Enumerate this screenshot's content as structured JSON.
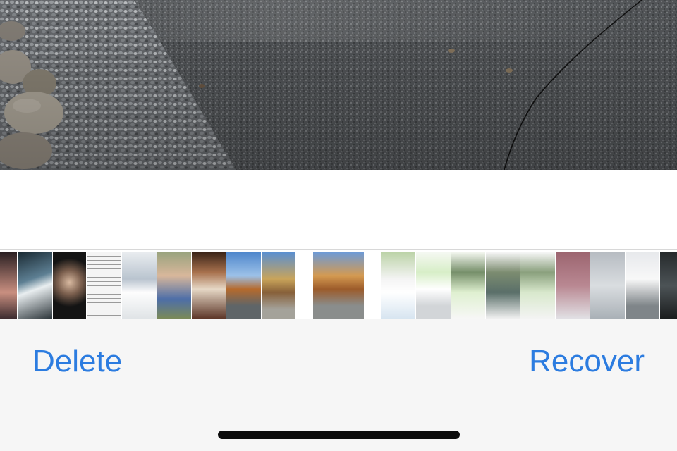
{
  "toolbar": {
    "delete_label": "Delete",
    "recover_label": "Recover",
    "accent_color": "#2c7ce0"
  },
  "main_photo": {
    "subject": "gravel-driveway-photo"
  },
  "thumbnails": [
    {
      "name": "thumb-group-selfie"
    },
    {
      "name": "thumb-car-dashboard"
    },
    {
      "name": "thumb-dark-portrait"
    },
    {
      "name": "thumb-document-text"
    },
    {
      "name": "thumb-paper-note"
    },
    {
      "name": "thumb-couple-photo"
    },
    {
      "name": "thumb-wooden-room"
    },
    {
      "name": "thumb-autumn-pond"
    },
    {
      "name": "thumb-autumn-path"
    },
    {
      "name": "thumb-selected-patio"
    },
    {
      "name": "thumb-real-estate-screenshot"
    },
    {
      "name": "thumb-chat-screenshot-1"
    },
    {
      "name": "thumb-chat-screenshot-2"
    },
    {
      "name": "thumb-chat-screenshot-3"
    },
    {
      "name": "thumb-chat-screenshot-4"
    },
    {
      "name": "thumb-pink-closeup"
    },
    {
      "name": "thumb-snowy-field"
    },
    {
      "name": "thumb-snowy-car"
    },
    {
      "name": "thumb-car-interior"
    }
  ]
}
